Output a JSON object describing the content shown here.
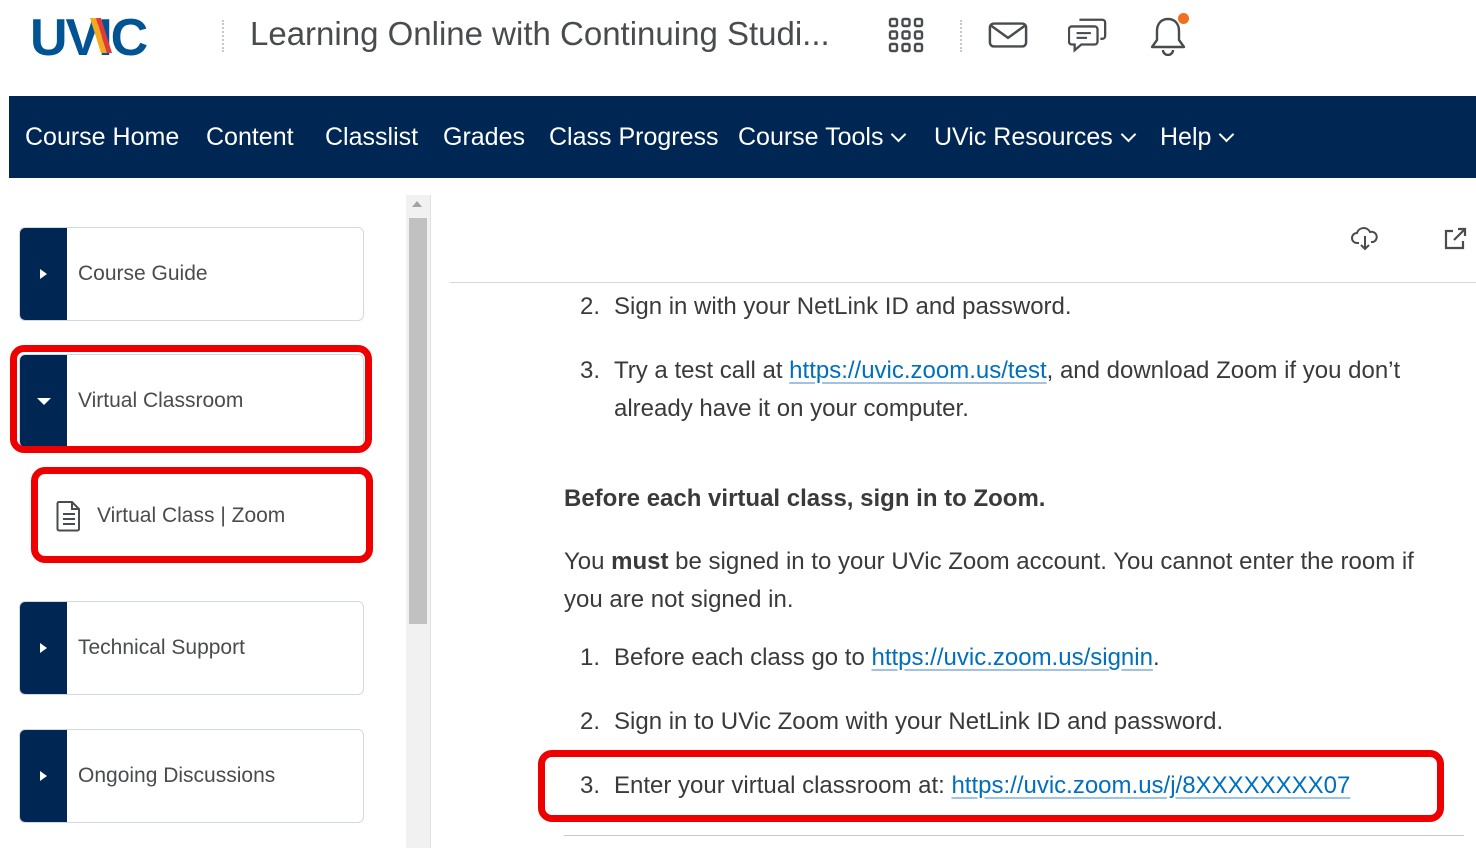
{
  "header": {
    "logo_text": "UVIC",
    "course_title": "Learning Online with Continuing Studi...",
    "icons": [
      "grid-icon",
      "mail-icon",
      "chat-icon",
      "bell-icon"
    ]
  },
  "nav": {
    "items": [
      {
        "label": "Course Home"
      },
      {
        "label": "Content"
      },
      {
        "label": "Classlist"
      },
      {
        "label": "Grades"
      },
      {
        "label": "Class Progress"
      },
      {
        "label": "Course Tools",
        "dropdown": true
      },
      {
        "label": "UVic Resources",
        "dropdown": true
      },
      {
        "label": "Help",
        "dropdown": true
      }
    ]
  },
  "sidebar": {
    "items": [
      {
        "label": "Course Guide",
        "expanded": false
      },
      {
        "label": "Virtual Classroom",
        "expanded": true
      },
      {
        "label": "Virtual Class | Zoom",
        "type": "topic"
      },
      {
        "label": "Technical Support",
        "expanded": false
      },
      {
        "label": "Ongoing Discussions",
        "expanded": false
      }
    ]
  },
  "content": {
    "list1": [
      {
        "num": "2.",
        "text": "Sign in with your NetLink ID and password."
      },
      {
        "num": "3.",
        "pre": "Try a test call at ",
        "link": "https://uvic.zoom.us/test",
        "post": ", and download Zoom if you don’t",
        "line2": "already have it on your computer."
      }
    ],
    "heading": "Before each virtual class, sign in to Zoom.",
    "para": {
      "pre": "You ",
      "strong": "must",
      "post": " be signed in to your UVic Zoom account. You cannot enter the room if",
      "line2": "you are not signed in."
    },
    "list2": [
      {
        "num": "1.",
        "pre": "Before each class go to ",
        "link": "https://uvic.zoom.us/signin",
        "post": "."
      },
      {
        "num": "2.",
        "text": "Sign in to UVic Zoom with your NetLink ID and password."
      },
      {
        "num": "3.",
        "pre": "Enter your virtual classroom at: ",
        "link": "https://uvic.zoom.us/j/8XXXXXXXX07"
      }
    ]
  },
  "colors": {
    "nav_bg": "#002754",
    "link": "#006fbf",
    "highlight": "#ee0000",
    "notification": "#f26f21"
  }
}
